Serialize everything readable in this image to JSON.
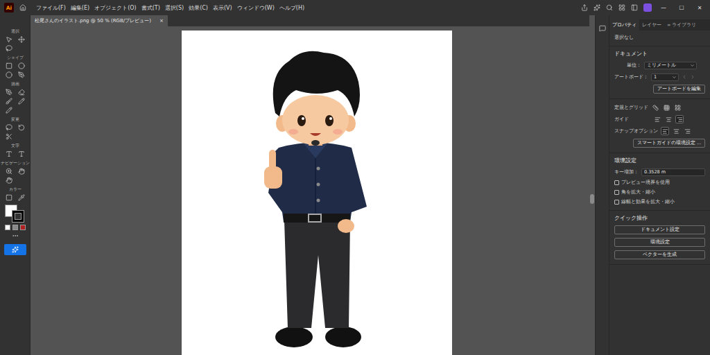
{
  "app": {
    "logo": "Ai"
  },
  "menu": [
    "ファイル(F)",
    "編集(E)",
    "オブジェクト(O)",
    "書式(T)",
    "選択(S)",
    "効果(C)",
    "表示(V)",
    "ウィンドウ(W)",
    "ヘルプ(H)"
  ],
  "window_controls": [
    "—",
    "☐",
    "✕"
  ],
  "document_tab": {
    "title": "松尾さんのイラスト.png @ 50 % (RGB/プレビュー)",
    "close": "×",
    "selected": true
  },
  "tool_sections": [
    "選択",
    "シェイプ",
    "描画",
    "変更",
    "文字",
    "ナビゲーション",
    "カラー"
  ],
  "panel_tabs": [
    {
      "label": "プロパティ",
      "selected": true
    },
    {
      "label": "レイヤー",
      "selected": false
    },
    {
      "label": "∞ ライブラリ",
      "selected": false
    }
  ],
  "selection": "選択なし",
  "document": {
    "heading": "ドキュメント",
    "unit_label": "単位：",
    "unit": "ミリメートル",
    "artboard_label": "アートボード：",
    "artboard": "1",
    "edit_button": "アートボードを編集"
  },
  "rulers": {
    "label": "定規とグリッド",
    "icons": [
      {
        "selected": false
      },
      {
        "selected": false
      },
      {
        "selected": false
      }
    ]
  },
  "guides": {
    "label": "ガイド",
    "icons": [
      {
        "selected": false
      },
      {
        "selected": false
      },
      {
        "selected": true
      }
    ]
  },
  "snap": {
    "label": "スナップオプション",
    "icons": [
      {
        "selected": true
      },
      {
        "selected": false
      },
      {
        "selected": false
      }
    ]
  },
  "smart_guides_button": "スマートガイドの環境設定 ...",
  "preferences": {
    "heading": "環境設定",
    "key_label": "キー増加：",
    "key_value": "0.3528 m",
    "checkboxes": [
      {
        "label": "プレビュー境界を使用",
        "checked": false
      },
      {
        "label": "角を拡大・縮小",
        "checked": false
      },
      {
        "label": "線幅と効果を拡大・縮小",
        "checked": false
      }
    ]
  },
  "quick_actions": {
    "heading": "クイック操作",
    "buttons": [
      "ドキュメント設定",
      "環境設定",
      "ベクターを生成"
    ]
  }
}
